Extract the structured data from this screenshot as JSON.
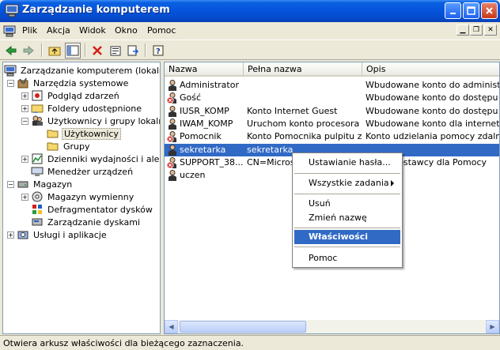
{
  "window": {
    "title": "Zarządzanie komputerem"
  },
  "menubar": [
    "Plik",
    "Akcja",
    "Widok",
    "Okno",
    "Pomoc"
  ],
  "tree": [
    {
      "label": "Zarządzanie komputerem (lokalne)",
      "icon": "computer-icon"
    },
    {
      "label": "Narzędzia systemowe",
      "icon": "tools-icon"
    },
    {
      "label": "Podgląd zdarzeń",
      "icon": "event-viewer-icon"
    },
    {
      "label": "Foldery udostępnione",
      "icon": "shared-folder-icon"
    },
    {
      "label": "Użytkownicy i grupy lokalne",
      "icon": "users-groups-icon"
    },
    {
      "label": "Użytkownicy",
      "icon": "folder-icon"
    },
    {
      "label": "Grupy",
      "icon": "folder-icon"
    },
    {
      "label": "Dzienniki wydajności i alerty",
      "icon": "performance-logs-icon"
    },
    {
      "label": "Menedżer urządzeń",
      "icon": "device-manager-icon"
    },
    {
      "label": "Magazyn",
      "icon": "storage-icon"
    },
    {
      "label": "Magazyn wymienny",
      "icon": "removable-storage-icon"
    },
    {
      "label": "Defragmentator dysków",
      "icon": "defragmenter-icon"
    },
    {
      "label": "Zarządzanie dyskami",
      "icon": "disk-management-icon"
    },
    {
      "label": "Usługi i aplikacje",
      "icon": "services-icon"
    }
  ],
  "columns": [
    "Nazwa",
    "Pełna nazwa",
    "Opis"
  ],
  "users": [
    {
      "name": "Administrator",
      "full": "",
      "desc": "Wbudowane konto do administrowania",
      "disabled": false
    },
    {
      "name": "Gość",
      "full": "",
      "desc": "Wbudowane konto do dostępu do ko",
      "disabled": true
    },
    {
      "name": "IUSR_KOMP",
      "full": "Konto Internet Guest",
      "desc": "Wbudowane konto do dostępu anonim",
      "disabled": false
    },
    {
      "name": "IWAM_KOMP",
      "full": "Uruchom konto procesora ...",
      "desc": "Wbudowane konto dla internetowy",
      "disabled": false
    },
    {
      "name": "Pomocnik",
      "full": "Konto Pomocnika pulpitu z...",
      "desc": "Konto udzielania pomocy zdalnej",
      "disabled": true
    },
    {
      "name": "sekretarka",
      "full": "sekretarka",
      "desc": "",
      "disabled": false
    },
    {
      "name": "SUPPORT_38...",
      "full": "CN=Microso",
      "desc": "konto dostawcy dla Pomocy",
      "disabled": true
    },
    {
      "name": "uczen",
      "full": "",
      "desc": "",
      "disabled": false
    }
  ],
  "context_menu": {
    "set_password": "Ustawianie hasła...",
    "all_tasks": "Wszystkie zadania",
    "delete": "Usuń",
    "rename": "Zmień nazwę",
    "properties": "Właściwości",
    "help": "Pomoc"
  },
  "status": "Otwiera arkusz właściwości dla bieżącego zaznaczenia.",
  "colors": {
    "selection": "#316ac5",
    "titlebar": "#0554dc"
  }
}
